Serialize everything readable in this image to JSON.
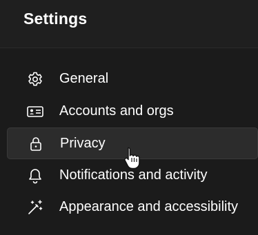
{
  "header": {
    "title": "Settings"
  },
  "menu": {
    "items": [
      {
        "label": "General",
        "icon": "gear-icon",
        "selected": false
      },
      {
        "label": "Accounts and orgs",
        "icon": "id-card-icon",
        "selected": false
      },
      {
        "label": "Privacy",
        "icon": "lock-icon",
        "selected": true
      },
      {
        "label": "Notifications and activity",
        "icon": "bell-icon",
        "selected": false
      },
      {
        "label": "Appearance and accessibility",
        "icon": "magic-wand-icon",
        "selected": false
      }
    ]
  },
  "colors": {
    "background": "#1b1b1b",
    "header_background": "#1f1f1f",
    "selected_background": "#2c2c2c",
    "text": "#ffffff"
  }
}
